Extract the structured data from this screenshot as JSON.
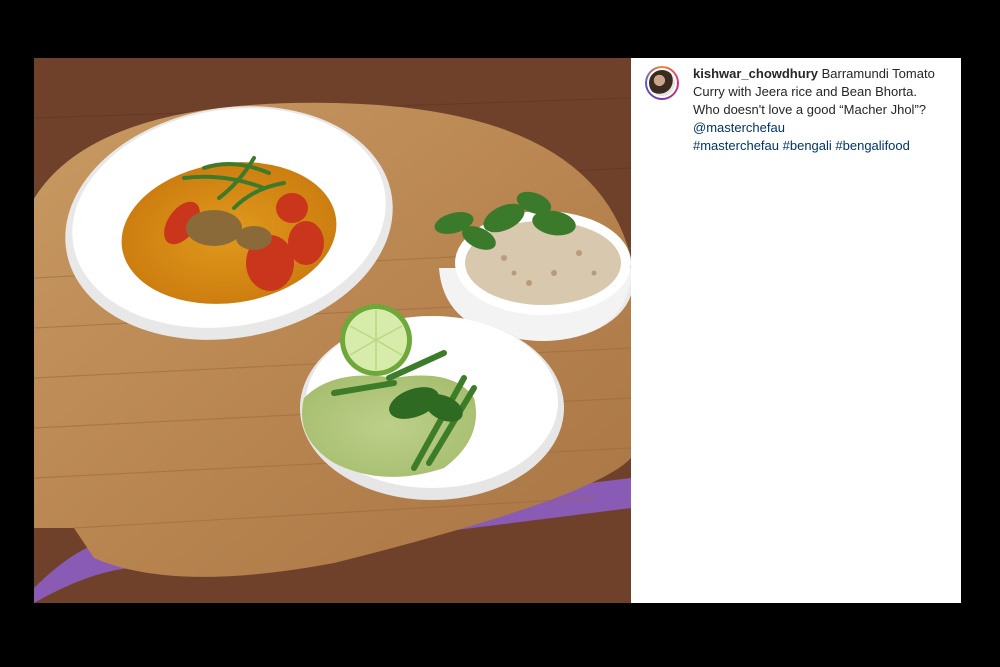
{
  "post": {
    "username": "kishwar_chowdhury",
    "caption_text": "Barramundi Tomato Curry with Jeera rice and Bean Bhorta. Who doesn't love a good “Macher Jhol”?",
    "mention": "@masterchefau",
    "hashtags": [
      "#masterchefau",
      "#bengali",
      "#bengalifood"
    ]
  },
  "icons": {
    "avatar": "profile-avatar"
  },
  "colors": {
    "page_background": "#000000",
    "panel_background": "#ffffff",
    "link": "#003569",
    "text": "#262626"
  }
}
